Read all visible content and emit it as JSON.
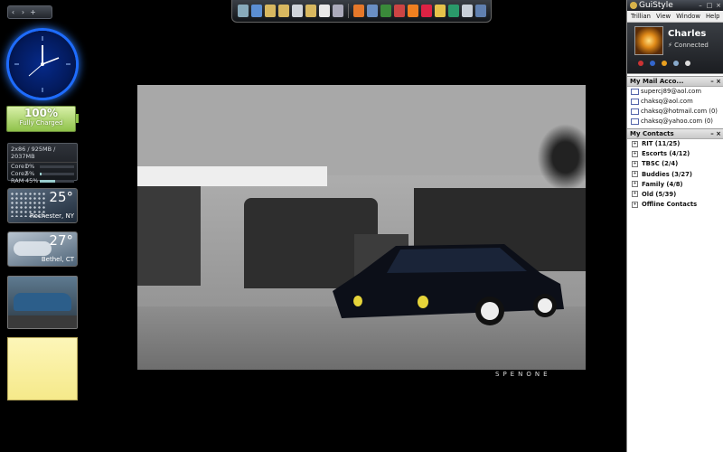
{
  "sidebar": {
    "controls": {
      "prev": "‹",
      "next": "›",
      "add": "+"
    },
    "battery": {
      "percent": "100%",
      "status": "Fully Charged"
    },
    "cpu_meter": {
      "header": "2x86 / 925MB / 2037MB",
      "rows": [
        {
          "label": "Core1",
          "value": "0%",
          "level": 0
        },
        {
          "label": "Core2",
          "value": "5%",
          "level": 0.05
        },
        {
          "label": "RAM",
          "value": "45%",
          "level": 0.45
        }
      ]
    },
    "weather": [
      {
        "temp": "25°",
        "location": "Rochester, NY"
      },
      {
        "temp": "27°",
        "location": "Bethel, CT"
      }
    ]
  },
  "wallpaper": {
    "watermark": "SPENONE"
  },
  "trillian": {
    "title": "GuiStyle",
    "menu": [
      "Trillian",
      "View",
      "Window",
      "Help"
    ],
    "profile": {
      "name": "Charles",
      "status": "Connected",
      "status_dots": [
        "#c33",
        "#36c",
        "#e8a020",
        "#8ac",
        "#ddd"
      ]
    },
    "mail_section": {
      "title": "My Mail Acco...",
      "accounts": [
        "supercj89@aol.com",
        "chaksq@aol.com",
        "chaksq@hotmail.com (0)",
        "chaksq@yahoo.com (0)"
      ]
    },
    "contacts_section": {
      "title": "My Contacts",
      "groups": [
        "RIT (11/25)",
        "Escorts (4/12)",
        "TBSC (2/4)",
        "Buddies (3/27)",
        "Family (4/8)",
        "Old (5/39)",
        "Offline Contacts"
      ]
    }
  },
  "dock": {
    "icon_names": [
      "computer",
      "globe",
      "folder",
      "folder",
      "folder",
      "folder",
      "document",
      "trash",
      "firefox",
      "media",
      "play",
      "burn",
      "vlc",
      "brush",
      "gear",
      "circle",
      "notes",
      "media-player"
    ],
    "colors": [
      "#8ab",
      "#5b8fd4",
      "#d8b860",
      "#d8b860",
      "#cfd4da",
      "#d8b860",
      "#e8e8e8",
      "#aab",
      "#e6782a",
      "#6a8fc4",
      "#3a8a3a",
      "#c44",
      "#f08020",
      "#d24",
      "#e6c24a",
      "#2a9a6a",
      "#c8cfd8",
      "#6080b0"
    ]
  }
}
